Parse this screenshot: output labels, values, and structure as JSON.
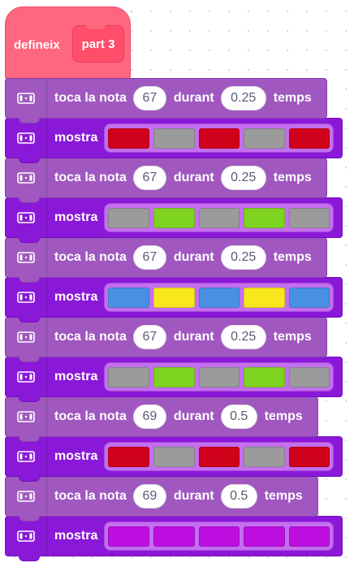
{
  "hat": {
    "label": "defineix",
    "argument": "part 3"
  },
  "strings": {
    "play": "toca la nota",
    "during": "durant",
    "beats": "temps",
    "show": "mostra"
  },
  "icons": {
    "block_icon": "led-matrix-icon"
  },
  "colors": {
    "red": "#d0021b",
    "gray": "#9b9b9b",
    "green": "#7ed321",
    "blue": "#4a90e2",
    "yellow": "#f8e71c",
    "purple": "#bd10e0"
  },
  "blocks": [
    {
      "type": "note",
      "note": "67",
      "beats": "0.25"
    },
    {
      "type": "show",
      "cells": [
        "red",
        "gray",
        "red",
        "gray",
        "red"
      ]
    },
    {
      "type": "note",
      "note": "67",
      "beats": "0.25"
    },
    {
      "type": "show",
      "cells": [
        "gray",
        "green",
        "gray",
        "green",
        "gray"
      ]
    },
    {
      "type": "note",
      "note": "67",
      "beats": "0.25"
    },
    {
      "type": "show",
      "cells": [
        "blue",
        "yellow",
        "blue",
        "yellow",
        "blue"
      ]
    },
    {
      "type": "note",
      "note": "67",
      "beats": "0.25"
    },
    {
      "type": "show",
      "cells": [
        "gray",
        "green",
        "gray",
        "green",
        "gray"
      ]
    },
    {
      "type": "note",
      "note": "69",
      "beats": "0.5"
    },
    {
      "type": "show",
      "cells": [
        "red",
        "gray",
        "red",
        "gray",
        "red"
      ]
    },
    {
      "type": "note",
      "note": "69",
      "beats": "0.5"
    },
    {
      "type": "show",
      "cells": [
        "purple",
        "purple",
        "purple",
        "purple",
        "purple"
      ]
    }
  ]
}
